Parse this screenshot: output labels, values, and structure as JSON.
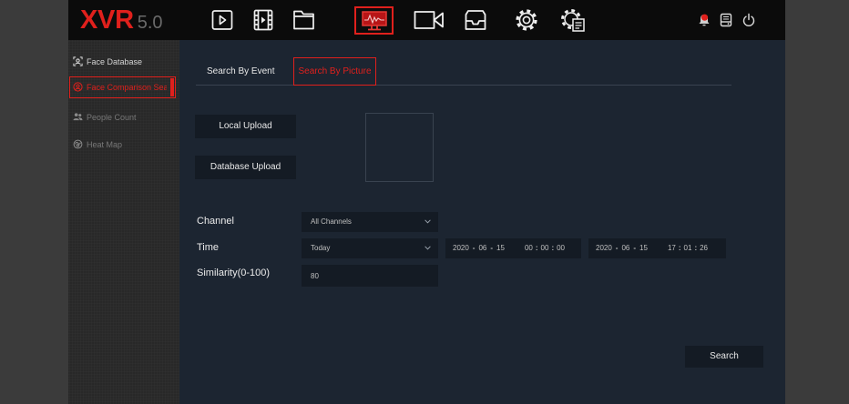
{
  "app": {
    "logo_main": "XVR",
    "logo_version": "5.0"
  },
  "topnav": {
    "items": [
      {
        "icon": "playback-icon",
        "active": false
      },
      {
        "icon": "video-file-icon",
        "active": false
      },
      {
        "icon": "folder-icon",
        "active": false
      },
      {
        "icon": "monitor-waveform-icon",
        "active": true
      },
      {
        "icon": "camera-icon",
        "active": false
      },
      {
        "icon": "inbox-icon",
        "active": false
      },
      {
        "icon": "gear-icon",
        "active": false
      },
      {
        "icon": "gear-document-icon",
        "active": false
      }
    ],
    "status_icons": [
      "alarm-bell-icon",
      "storage-icon",
      "power-icon"
    ]
  },
  "sidebar": {
    "items": [
      {
        "label": "Face Database",
        "icon": "face-database-icon",
        "active": false,
        "enabled": true
      },
      {
        "label": "Face Comparison Sea",
        "icon": "face-comparison-icon",
        "active": true,
        "enabled": true
      },
      {
        "label": "People Count",
        "icon": "people-count-icon",
        "active": false,
        "enabled": false
      },
      {
        "label": "Heat Map",
        "icon": "heat-map-icon",
        "active": false,
        "enabled": false
      }
    ]
  },
  "tabs": [
    {
      "label": "Search By Event",
      "active": false
    },
    {
      "label": "Search By Picture",
      "active": true
    }
  ],
  "upload": {
    "local_label": "Local Upload",
    "database_label": "Database Upload"
  },
  "form": {
    "channel": {
      "label": "Channel",
      "value": "All Channels"
    },
    "time": {
      "label": "Time",
      "value": "Today",
      "date_separator": "-",
      "time_separator": ":",
      "start": {
        "year": "2020",
        "month": "06",
        "day": "15",
        "hour": "00",
        "minute": "00",
        "second": "00"
      },
      "end": {
        "year": "2020",
        "month": "06",
        "day": "15",
        "hour": "17",
        "minute": "01",
        "second": "26"
      }
    },
    "similarity": {
      "label": "Similarity(0-100)",
      "value": "80"
    }
  },
  "actions": {
    "search_label": "Search"
  },
  "colors": {
    "accent": "#e0201c",
    "frame": "#3b3b3b",
    "topbar": "#0b0b0b",
    "sidebar": "#282828",
    "content": "#1c2531",
    "field": "#141b24",
    "line": "#394350"
  }
}
